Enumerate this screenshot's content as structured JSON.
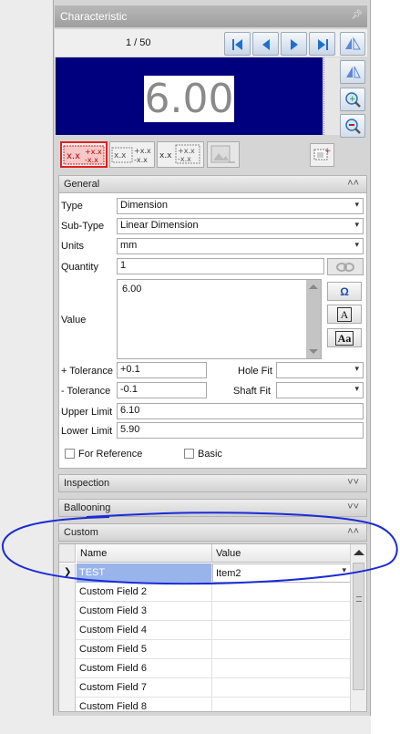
{
  "panel": {
    "title": "Characteristic"
  },
  "nav": {
    "counter": "1 / 50"
  },
  "display": {
    "value": "6.00"
  },
  "formats": [
    {
      "icon": "tolerance-format-icon"
    },
    {
      "icon": "tolerance-format-icon"
    },
    {
      "icon": "tolerance-format-icon"
    }
  ],
  "general": {
    "header": "General",
    "type_label": "Type",
    "type_value": "Dimension",
    "subtype_label": "Sub-Type",
    "subtype_value": "Linear Dimension",
    "units_label": "Units",
    "units_value": "mm",
    "quantity_label": "Quantity",
    "quantity_value": "1",
    "value_label": "Value",
    "value_text": "6.00",
    "plus_tol_label": "+ Tolerance",
    "plus_tol_value": "+0.1",
    "minus_tol_label": "- Tolerance",
    "minus_tol_value": "-0.1",
    "hole_fit_label": "Hole Fit",
    "hole_fit_value": "",
    "shaft_fit_label": "Shaft Fit",
    "shaft_fit_value": "",
    "upper_label": "Upper Limit",
    "upper_value": "6.10",
    "lower_label": "Lower Limit",
    "lower_value": "5.90",
    "for_reference_label": "For Reference",
    "basic_label": "Basic",
    "omega_btn": "Ω",
    "a_btn": "A",
    "aa_btn": "Aa"
  },
  "sections": {
    "inspection": "Inspection",
    "ballooning": "Ballooning",
    "custom": "Custom"
  },
  "custom_grid": {
    "columns": [
      "Name",
      "Value"
    ],
    "rows": [
      {
        "name": "TEST",
        "value": "Item2"
      },
      {
        "name": "Custom Field 2",
        "value": ""
      },
      {
        "name": "Custom Field 3",
        "value": ""
      },
      {
        "name": "Custom Field 4",
        "value": ""
      },
      {
        "name": "Custom Field 5",
        "value": ""
      },
      {
        "name": "Custom Field 6",
        "value": ""
      },
      {
        "name": "Custom Field 7",
        "value": ""
      },
      {
        "name": "Custom Field 8",
        "value": ""
      }
    ]
  },
  "colors": {
    "display_bg": "#00007f",
    "annotation": "#1a2bd6",
    "selected_row": "#99b4ea"
  }
}
